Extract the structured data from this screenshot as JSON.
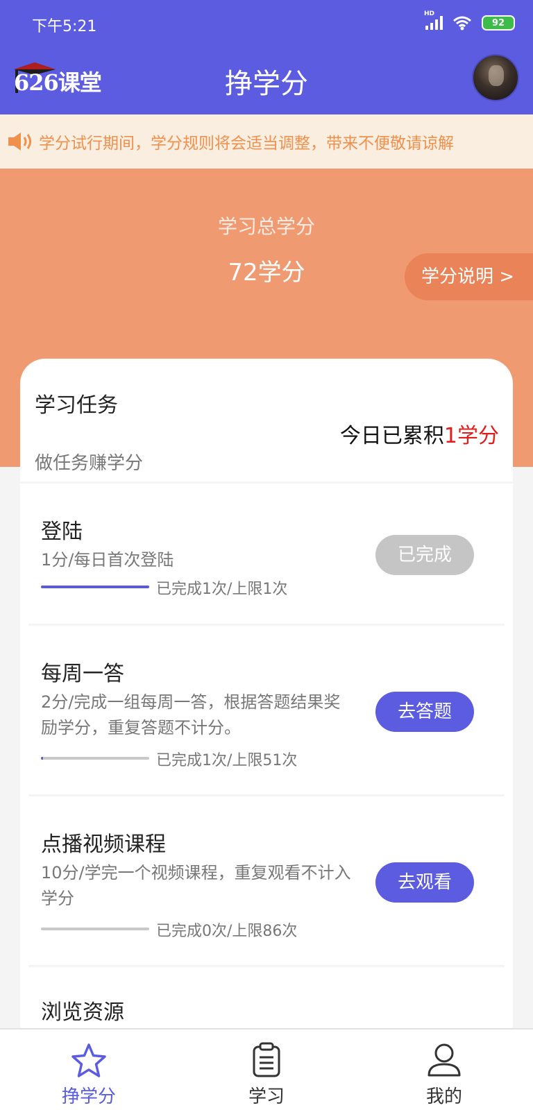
{
  "status_bar": {
    "time": "下午5:21",
    "battery": "92",
    "network_badge": "HD"
  },
  "header": {
    "logo_text": "626课堂",
    "title": "挣学分"
  },
  "notice": {
    "text": "学分试行期间，学分规则将会适当调整，带来不便敬请谅解"
  },
  "summary": {
    "label": "学习总学分",
    "value": "72学分",
    "info_button": "学分说明 >"
  },
  "task_section": {
    "title": "学习任务",
    "subtitle": "做任务赚学分",
    "today_prefix": "今日已累积",
    "today_value": "1学分"
  },
  "tasks": [
    {
      "name": "登陆",
      "desc": "1分/每日首次登陆",
      "progress_text": "已完成1次/上限1次",
      "progress": 1.0,
      "button": "已完成"
    },
    {
      "name": "每周一答",
      "desc": "2分/完成一组每周一答，根据答题结果奖励学分，重复答题不计分。",
      "progress_text": "已完成1次/上限51次",
      "progress": 0.0196,
      "button": "去答题"
    },
    {
      "name": "点播视频课程",
      "desc": "10分/学完一个视频课程，重复观看不计入学分",
      "progress_text": "已完成0次/上限86次",
      "progress": 0,
      "button": "去观看"
    },
    {
      "name": "浏览资源"
    }
  ],
  "tabbar": {
    "items": [
      {
        "label": "挣学分",
        "icon": "star-icon",
        "active": true
      },
      {
        "label": "学习",
        "icon": "clipboard-icon",
        "active": false
      },
      {
        "label": "我的",
        "icon": "user-icon",
        "active": false
      }
    ]
  },
  "colors": {
    "primary": "#5b5ce0",
    "hero": "#ef9a70",
    "notice_text": "#f0904d",
    "highlight_red": "#e21b1b"
  }
}
